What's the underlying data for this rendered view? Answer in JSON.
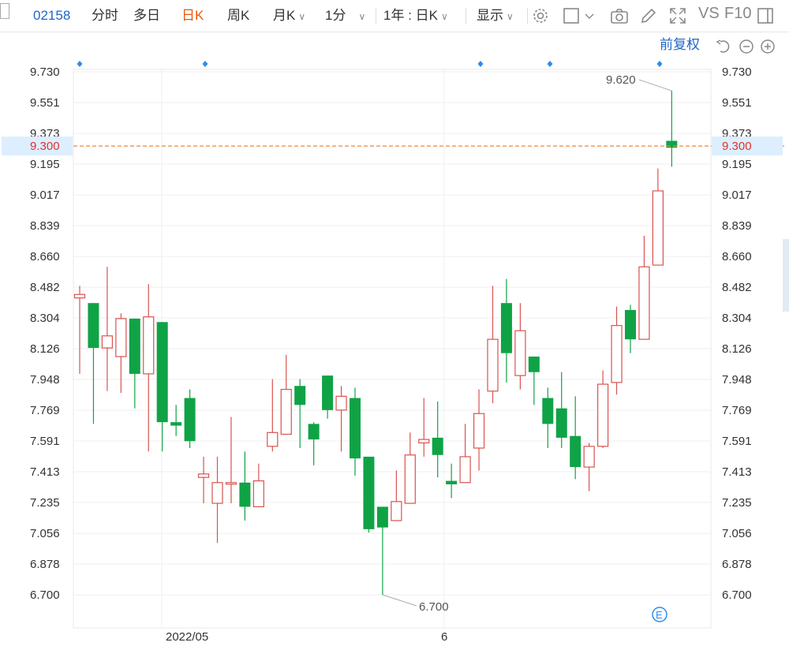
{
  "toolbar": {
    "code": "02158",
    "tabs": [
      "分时",
      "多日",
      "日K",
      "周K",
      "月K"
    ],
    "active_tab": "日K",
    "interval": "1分",
    "range": "1年 : 日K",
    "display": "显示",
    "vs": "VS",
    "f10": "F10",
    "icons": [
      "settings-icon",
      "checkbox-icon",
      "camera-icon",
      "pen-icon",
      "fullscreen-icon",
      "panel-icon"
    ]
  },
  "chart_controls": {
    "adjust": "前复权",
    "icons": [
      "undo-icon",
      "zoom-out-icon",
      "zoom-in-icon"
    ]
  },
  "colors": {
    "up": "#d9534f",
    "down": "#0fa346",
    "price_line": "#e88a3a",
    "price_label_bg": "#ddeeff",
    "price_label_text": "#e0322d",
    "marker": "#2d8cf0",
    "axis_text": "#333333"
  },
  "chart_data": {
    "type": "candlestick",
    "y_ticks": [
      "9.730",
      "9.551",
      "9.373",
      "9.195",
      "9.017",
      "8.839",
      "8.660",
      "8.482",
      "8.304",
      "8.126",
      "7.948",
      "7.769",
      "7.591",
      "7.413",
      "7.235",
      "7.056",
      "6.878",
      "6.700"
    ],
    "ylim": [
      6.7,
      9.73
    ],
    "x_labels": [
      "2022/05",
      "6"
    ],
    "current_price": "9.300",
    "high_annotation": "9.620",
    "low_annotation": "6.700",
    "candles": [
      {
        "o": 8.42,
        "c": 8.44,
        "h": 8.49,
        "l": 7.98
      },
      {
        "o": 8.39,
        "c": 8.13,
        "h": 8.39,
        "l": 7.69
      },
      {
        "o": 8.13,
        "c": 8.2,
        "h": 8.6,
        "l": 7.88
      },
      {
        "o": 8.08,
        "c": 8.3,
        "h": 8.33,
        "l": 7.87
      },
      {
        "o": 8.3,
        "c": 7.98,
        "h": 8.3,
        "l": 7.78
      },
      {
        "o": 7.98,
        "c": 8.31,
        "h": 8.5,
        "l": 7.53
      },
      {
        "o": 8.28,
        "c": 7.7,
        "h": 8.28,
        "l": 7.53
      },
      {
        "o": 7.7,
        "c": 7.68,
        "h": 7.8,
        "l": 7.62
      },
      {
        "o": 7.84,
        "c": 7.59,
        "h": 7.89,
        "l": 7.55
      },
      {
        "o": 7.38,
        "c": 7.4,
        "h": 7.5,
        "l": 7.23
      },
      {
        "o": 7.23,
        "c": 7.35,
        "h": 7.5,
        "l": 7.0
      },
      {
        "o": 7.35,
        "c": 7.35,
        "h": 7.73,
        "l": 7.23
      },
      {
        "o": 7.35,
        "c": 7.21,
        "h": 7.53,
        "l": 7.13
      },
      {
        "o": 7.21,
        "c": 7.36,
        "h": 7.46,
        "l": 7.21
      },
      {
        "o": 7.56,
        "c": 7.64,
        "h": 7.95,
        "l": 7.53
      },
      {
        "o": 7.63,
        "c": 7.89,
        "h": 8.09,
        "l": 7.63
      },
      {
        "o": 7.91,
        "c": 7.8,
        "h": 7.95,
        "l": 7.55
      },
      {
        "o": 7.69,
        "c": 7.6,
        "h": 7.7,
        "l": 7.45
      },
      {
        "o": 7.97,
        "c": 7.77,
        "h": 7.97,
        "l": 7.72
      },
      {
        "o": 7.77,
        "c": 7.85,
        "h": 7.91,
        "l": 7.53
      },
      {
        "o": 7.84,
        "c": 7.49,
        "h": 7.9,
        "l": 7.39
      },
      {
        "o": 7.5,
        "c": 7.08,
        "h": 7.5,
        "l": 7.06
      },
      {
        "o": 7.21,
        "c": 7.09,
        "h": 7.21,
        "l": 6.7
      },
      {
        "o": 7.13,
        "c": 7.24,
        "h": 7.42,
        "l": 7.13
      },
      {
        "o": 7.23,
        "c": 7.51,
        "h": 7.64,
        "l": 7.23
      },
      {
        "o": 7.58,
        "c": 7.6,
        "h": 7.84,
        "l": 7.5
      },
      {
        "o": 7.61,
        "c": 7.51,
        "h": 7.82,
        "l": 7.38
      },
      {
        "o": 7.36,
        "c": 7.34,
        "h": 7.46,
        "l": 7.26
      },
      {
        "o": 7.35,
        "c": 7.5,
        "h": 7.69,
        "l": 7.35
      },
      {
        "o": 7.55,
        "c": 7.75,
        "h": 7.89,
        "l": 7.42
      },
      {
        "o": 7.88,
        "c": 8.18,
        "h": 8.49,
        "l": 7.81
      },
      {
        "o": 8.39,
        "c": 8.1,
        "h": 8.53,
        "l": 7.93
      },
      {
        "o": 7.97,
        "c": 8.23,
        "h": 8.39,
        "l": 7.89
      },
      {
        "o": 8.08,
        "c": 7.99,
        "h": 8.08,
        "l": 7.8
      },
      {
        "o": 7.84,
        "c": 7.69,
        "h": 7.9,
        "l": 7.55
      },
      {
        "o": 7.78,
        "c": 7.61,
        "h": 7.99,
        "l": 7.55
      },
      {
        "o": 7.62,
        "c": 7.44,
        "h": 7.85,
        "l": 7.37
      },
      {
        "o": 7.44,
        "c": 7.56,
        "h": 7.58,
        "l": 7.3
      },
      {
        "o": 7.56,
        "c": 7.92,
        "h": 8.0,
        "l": 7.55
      },
      {
        "o": 7.93,
        "c": 8.26,
        "h": 8.37,
        "l": 7.86
      },
      {
        "o": 8.35,
        "c": 8.18,
        "h": 8.38,
        "l": 8.1
      },
      {
        "o": 8.18,
        "c": 8.6,
        "h": 8.78,
        "l": 8.18
      },
      {
        "o": 8.61,
        "c": 9.04,
        "h": 9.17,
        "l": 8.61
      },
      {
        "o": 9.33,
        "c": 9.29,
        "h": 9.62,
        "l": 9.18
      }
    ]
  }
}
